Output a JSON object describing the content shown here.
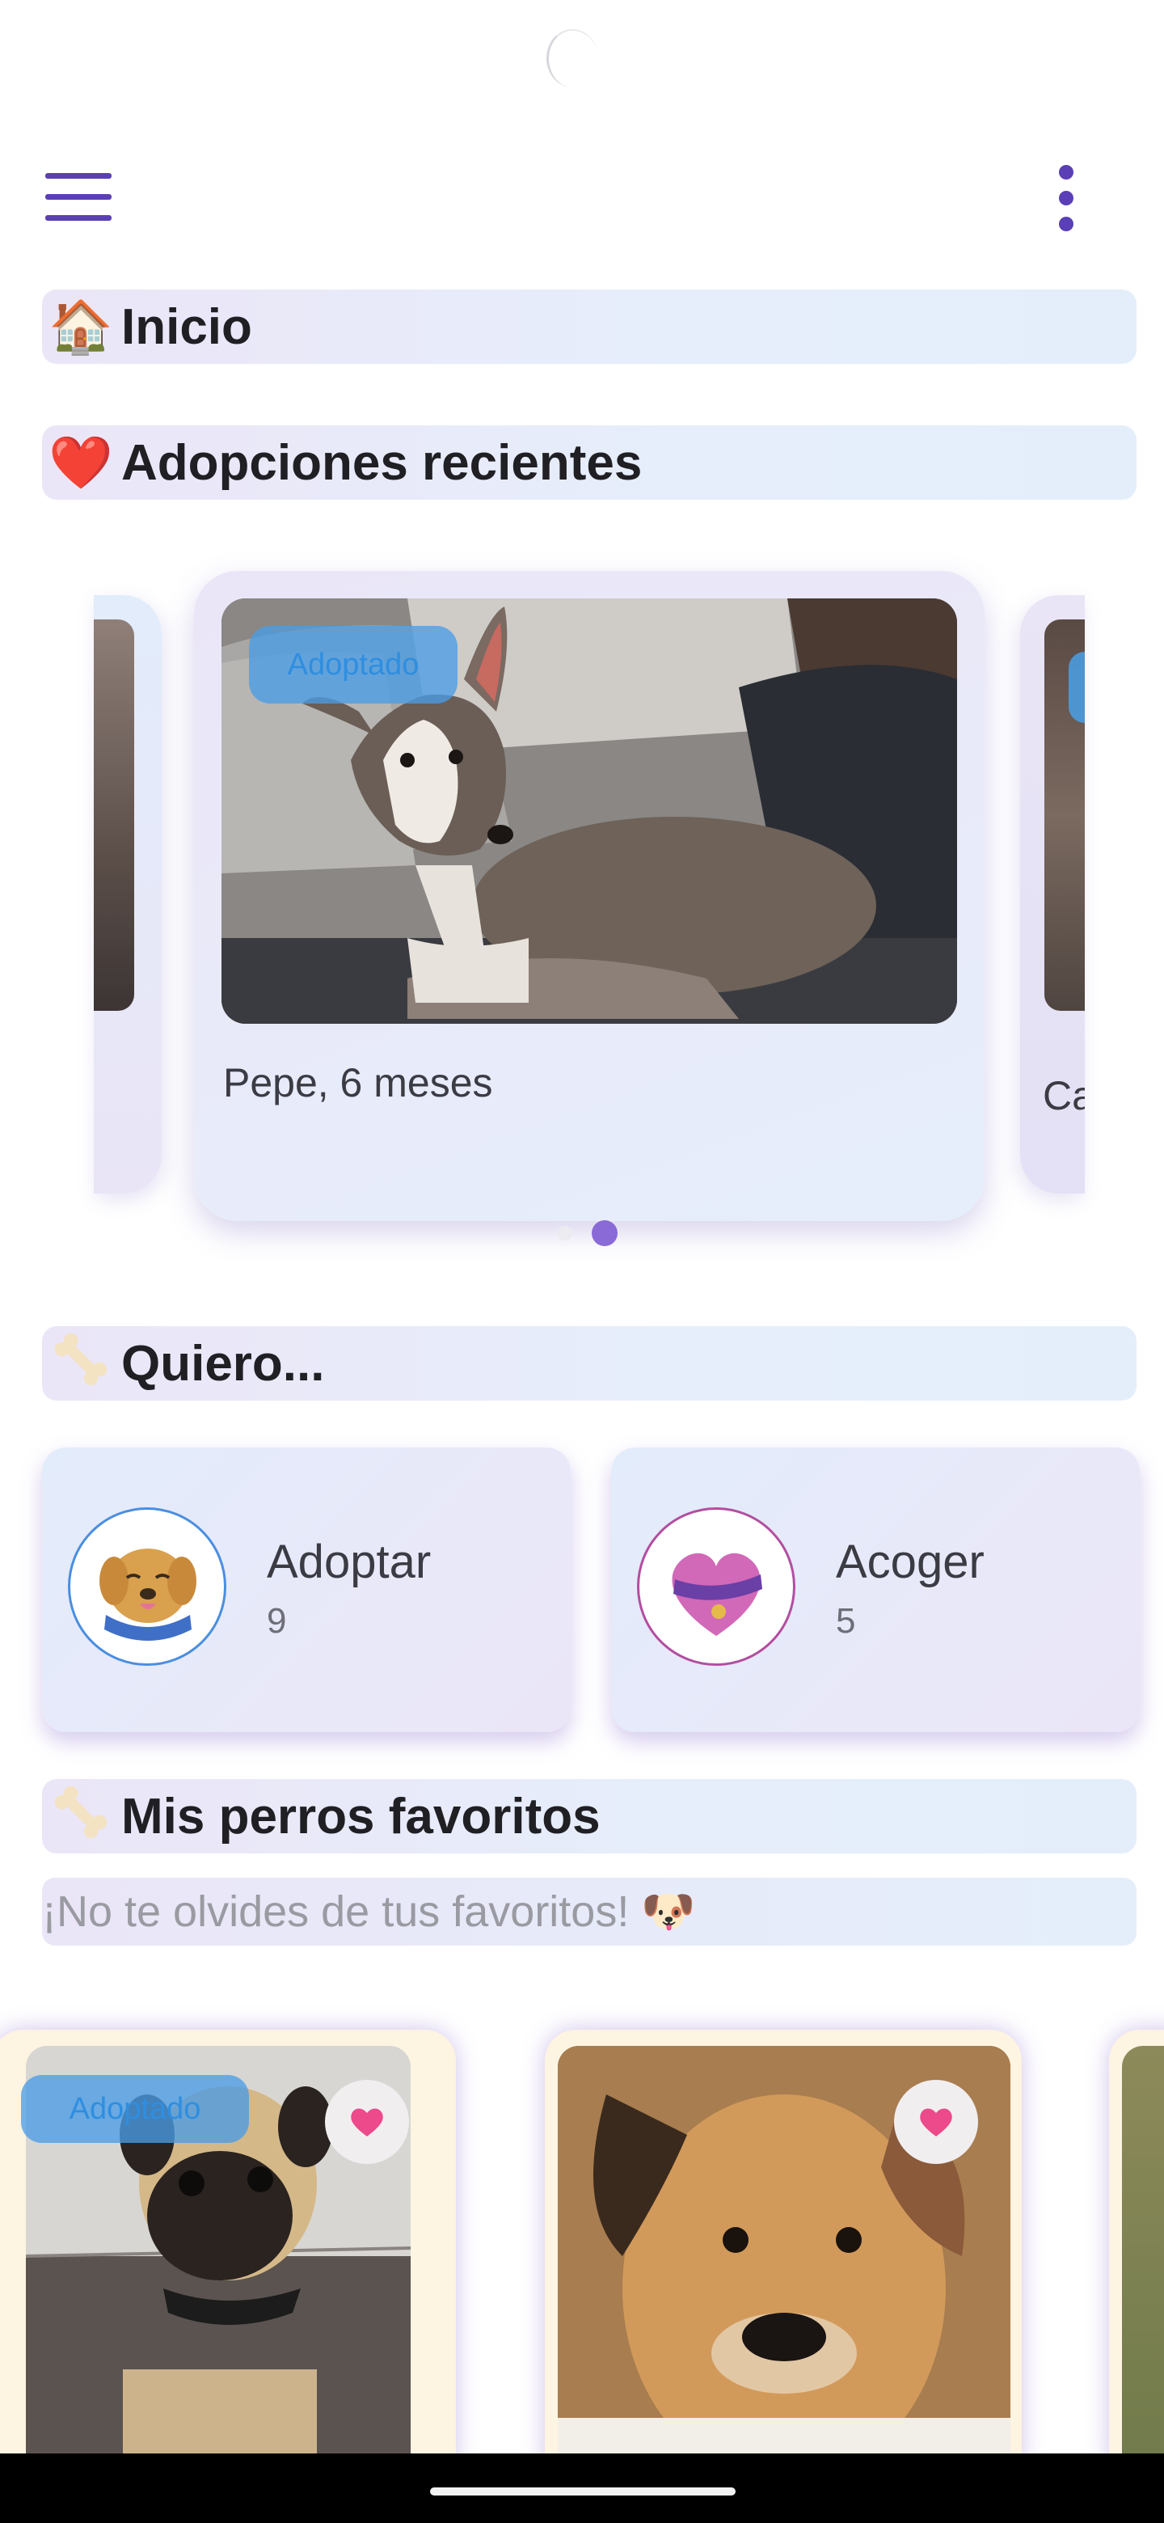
{
  "sections": {
    "home": {
      "emoji": "🏠",
      "title": "Inicio"
    },
    "recent": {
      "emoji": "❤️",
      "title": "Adopciones recientes"
    },
    "want": {
      "title": "Quiero..."
    },
    "favorites": {
      "title": "Mis perros favoritos"
    }
  },
  "carousel": {
    "current": {
      "name": "Pepe, 6 meses",
      "badge": "Adoptado"
    },
    "next_partial_label": "Ca",
    "page_count": 2,
    "active_page": 2
  },
  "actions": [
    {
      "label": "Adoptar",
      "count": "9",
      "icon": "dog-icon"
    },
    {
      "label": "Acoger",
      "count": "5",
      "icon": "heart-collar-icon"
    }
  ],
  "favorites_hint": "¡No te olvides de tus favoritos! 🐶",
  "favorites": [
    {
      "badge": "Adoptado",
      "favorite": true,
      "icon": "heart-icon"
    },
    {
      "badge": "",
      "favorite": true,
      "icon": "heart-icon"
    }
  ],
  "colors": {
    "accent": "#5b3fb6",
    "badge_blue": "#4a9ce6",
    "heart_pink": "#ec4a8a"
  }
}
